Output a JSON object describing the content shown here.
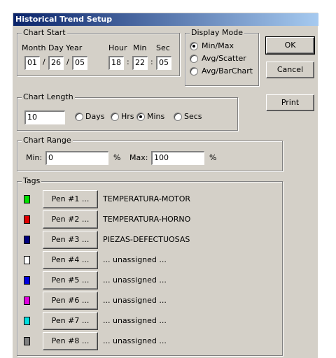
{
  "window": {
    "title": "Historical Trend Setup"
  },
  "chart_start": {
    "legend": "Chart Start",
    "labels": {
      "month": "Month",
      "day": "Day",
      "year": "Year",
      "hour": "Hour",
      "min": "Min",
      "sec": "Sec"
    },
    "values": {
      "month": "01",
      "day": "26",
      "year": "05",
      "hour": "18",
      "min": "22",
      "sec": "05"
    },
    "date_sep": "/",
    "time_sep": ":"
  },
  "display_mode": {
    "legend": "Display Mode",
    "options": [
      "Min/Max",
      "Avg/Scatter",
      "Avg/BarChart"
    ],
    "selected": "Min/Max"
  },
  "buttons": {
    "ok": "OK",
    "cancel": "Cancel",
    "print": "Print"
  },
  "chart_length": {
    "legend": "Chart Length",
    "value": "10",
    "units": [
      "Days",
      "Hrs",
      "Mins",
      "Secs"
    ],
    "selected": "Mins"
  },
  "chart_range": {
    "legend": "Chart Range",
    "min_label": "Min:",
    "min_value": "0",
    "max_label": "Max:",
    "max_value": "100",
    "unit": "%"
  },
  "tags": {
    "legend": "Tags",
    "pens": [
      {
        "button": "Pen #1 ...",
        "name": "TEMPERATURA-MOTOR",
        "color": "#00e000"
      },
      {
        "button": "Pen #2 ...",
        "name": "TEMPERATURA-HORNO",
        "color": "#e00000"
      },
      {
        "button": "Pen #3 ...",
        "name": "PIEZAS-DEFECTUOSAS",
        "color": "#000080"
      },
      {
        "button": "Pen #4 ...",
        "name": "... unassigned ...",
        "color": "#ffffff"
      },
      {
        "button": "Pen #5 ...",
        "name": "... unassigned ...",
        "color": "#0000e0"
      },
      {
        "button": "Pen #6 ...",
        "name": "... unassigned ...",
        "color": "#e000e0"
      },
      {
        "button": "Pen #7 ...",
        "name": "... unassigned ...",
        "color": "#00e0e0"
      },
      {
        "button": "Pen #8 ...",
        "name": "... unassigned ...",
        "color": "#808080"
      }
    ]
  }
}
